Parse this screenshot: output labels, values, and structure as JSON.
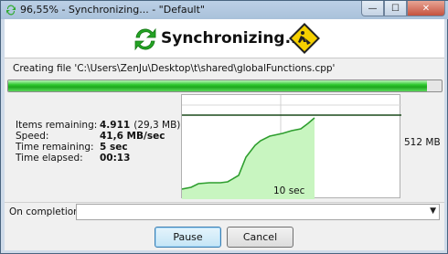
{
  "window": {
    "title": "96,55% - Synchronizing... - \"Default\"",
    "minimize_glyph": "—",
    "maximize_glyph": "☐",
    "close_glyph": "✕"
  },
  "header": {
    "status": "Synchronizing...",
    "sync_icon": "sync-arrows-icon",
    "status_image": "warning-sign-icon"
  },
  "current_action": "Creating file 'C:\\Users\\ZenJu\\Desktop\\t\\shared\\globalFunctions.cpp'",
  "progress": {
    "percent": 96.55
  },
  "stats": {
    "items_remaining_label": "Items remaining:",
    "items_remaining_value": "4.911",
    "items_remaining_size": "(29,3 MB)",
    "speed_label": "Speed:",
    "speed_value": "41,6 MB/sec",
    "time_remaining_label": "Time remaining:",
    "time_remaining_value": "5 sec",
    "time_elapsed_label": "Time elapsed:",
    "time_elapsed_value": "00:13"
  },
  "graph": {
    "y_label": "512 MB",
    "x_label": "10 sec",
    "fill_color": "#c8f5c0",
    "line_color": "#2e9e2e"
  },
  "completion": {
    "label": "On completion",
    "value": ""
  },
  "buttons": {
    "pause": "Pause",
    "cancel": "Cancel"
  }
}
